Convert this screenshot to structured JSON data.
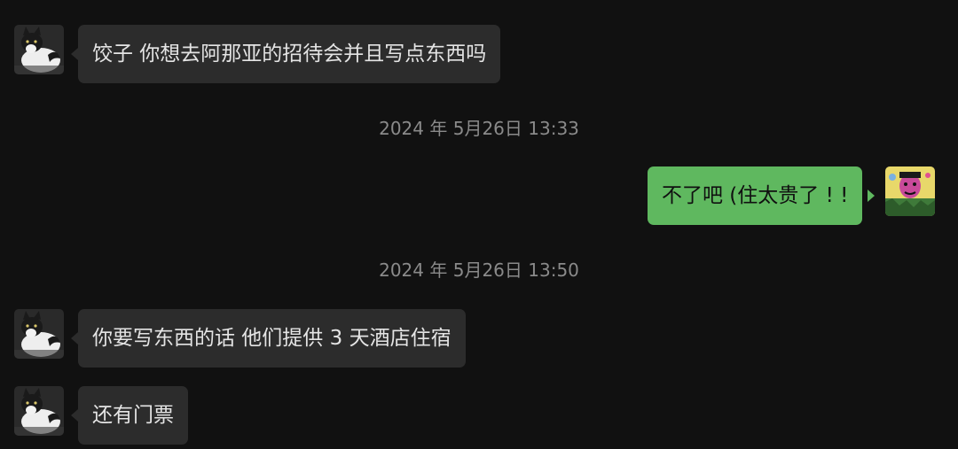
{
  "messages": [
    {
      "sender": "other",
      "text": "饺子 你想去阿那亚的招待会并且写点东西吗",
      "avatar_icon": "cat-avatar-icon"
    },
    {
      "sender": "me",
      "text": "不了吧 (住太贵了 ! !",
      "avatar_icon": "cartoon-avatar-icon"
    },
    {
      "sender": "other",
      "text": "你要写东西的话 他们提供 3 天酒店住宿",
      "avatar_icon": "cat-avatar-icon"
    },
    {
      "sender": "other",
      "text": "还有门票",
      "avatar_icon": "cat-avatar-icon"
    }
  ],
  "timestamps": [
    "2024 年 5月26日 13:33",
    "2024 年 5月26日 13:50"
  ],
  "colors": {
    "background": "#111111",
    "incoming_bubble": "#2c2c2c",
    "outgoing_bubble": "#5fb85f",
    "incoming_text": "#e4e4e4",
    "outgoing_text": "#101010",
    "timestamp_text": "#8a8a8a"
  }
}
